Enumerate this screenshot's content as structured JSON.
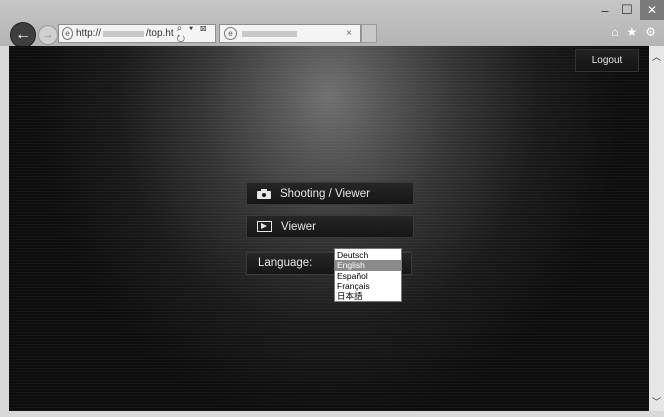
{
  "browser": {
    "window_controls": {
      "minimize": "–",
      "maximize": "☐",
      "close": "✕"
    },
    "address_prefix": "http://",
    "address_suffix": "/top.ht",
    "address_tools": "⌕ ▾ ⊠ ↻",
    "tab_close": "×",
    "toolbar_icons": [
      "home-icon",
      "star-icon",
      "gear-icon"
    ]
  },
  "page": {
    "logout_label": "Logout",
    "menu": [
      {
        "label": "Shooting / Viewer",
        "icon": "camera-icon"
      },
      {
        "label": "Viewer",
        "icon": "play-icon"
      }
    ],
    "language": {
      "label": "Language:",
      "options": [
        "Deutsch",
        "English",
        "Español",
        "Français",
        "日本語"
      ],
      "selected": "English"
    }
  },
  "colors": {
    "background": "#0d0d0d",
    "button": "#1c1c1c",
    "button_text": "#e6e6e6",
    "selected_option": "#8a8a8a"
  }
}
